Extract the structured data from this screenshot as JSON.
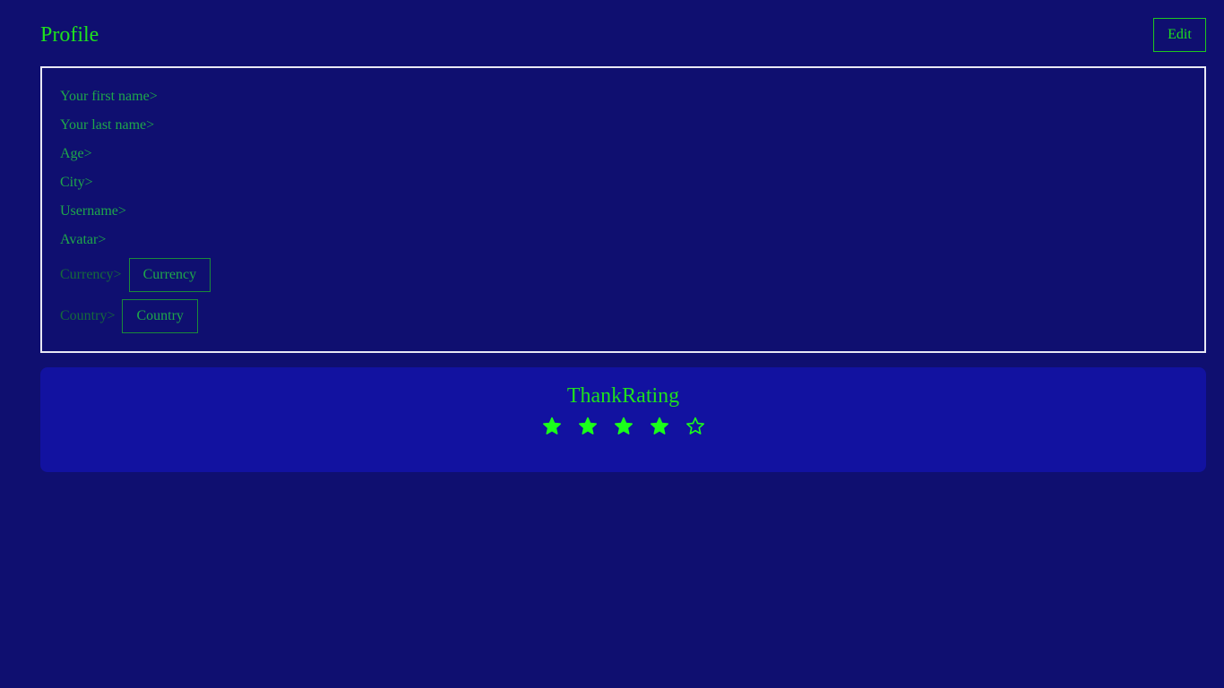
{
  "header": {
    "title": "Profile",
    "edit_label": "Edit"
  },
  "profile": {
    "first_name_label": "Your first name>",
    "last_name_label": "Your last name>",
    "age_label": "Age>",
    "city_label": "City>",
    "username_label": "Username>",
    "avatar_label": "Avatar>",
    "currency": {
      "label": "Currency>",
      "selected": "Currency"
    },
    "country": {
      "label": "Country>",
      "selected": "Country"
    }
  },
  "rating": {
    "title": "ThankRating",
    "value": 4,
    "max": 5,
    "icon": "star-icon"
  },
  "colors": {
    "background": "#0f0f70",
    "card": "#1212a0",
    "accent": "#1ee01e",
    "star": "#1aff1a"
  }
}
